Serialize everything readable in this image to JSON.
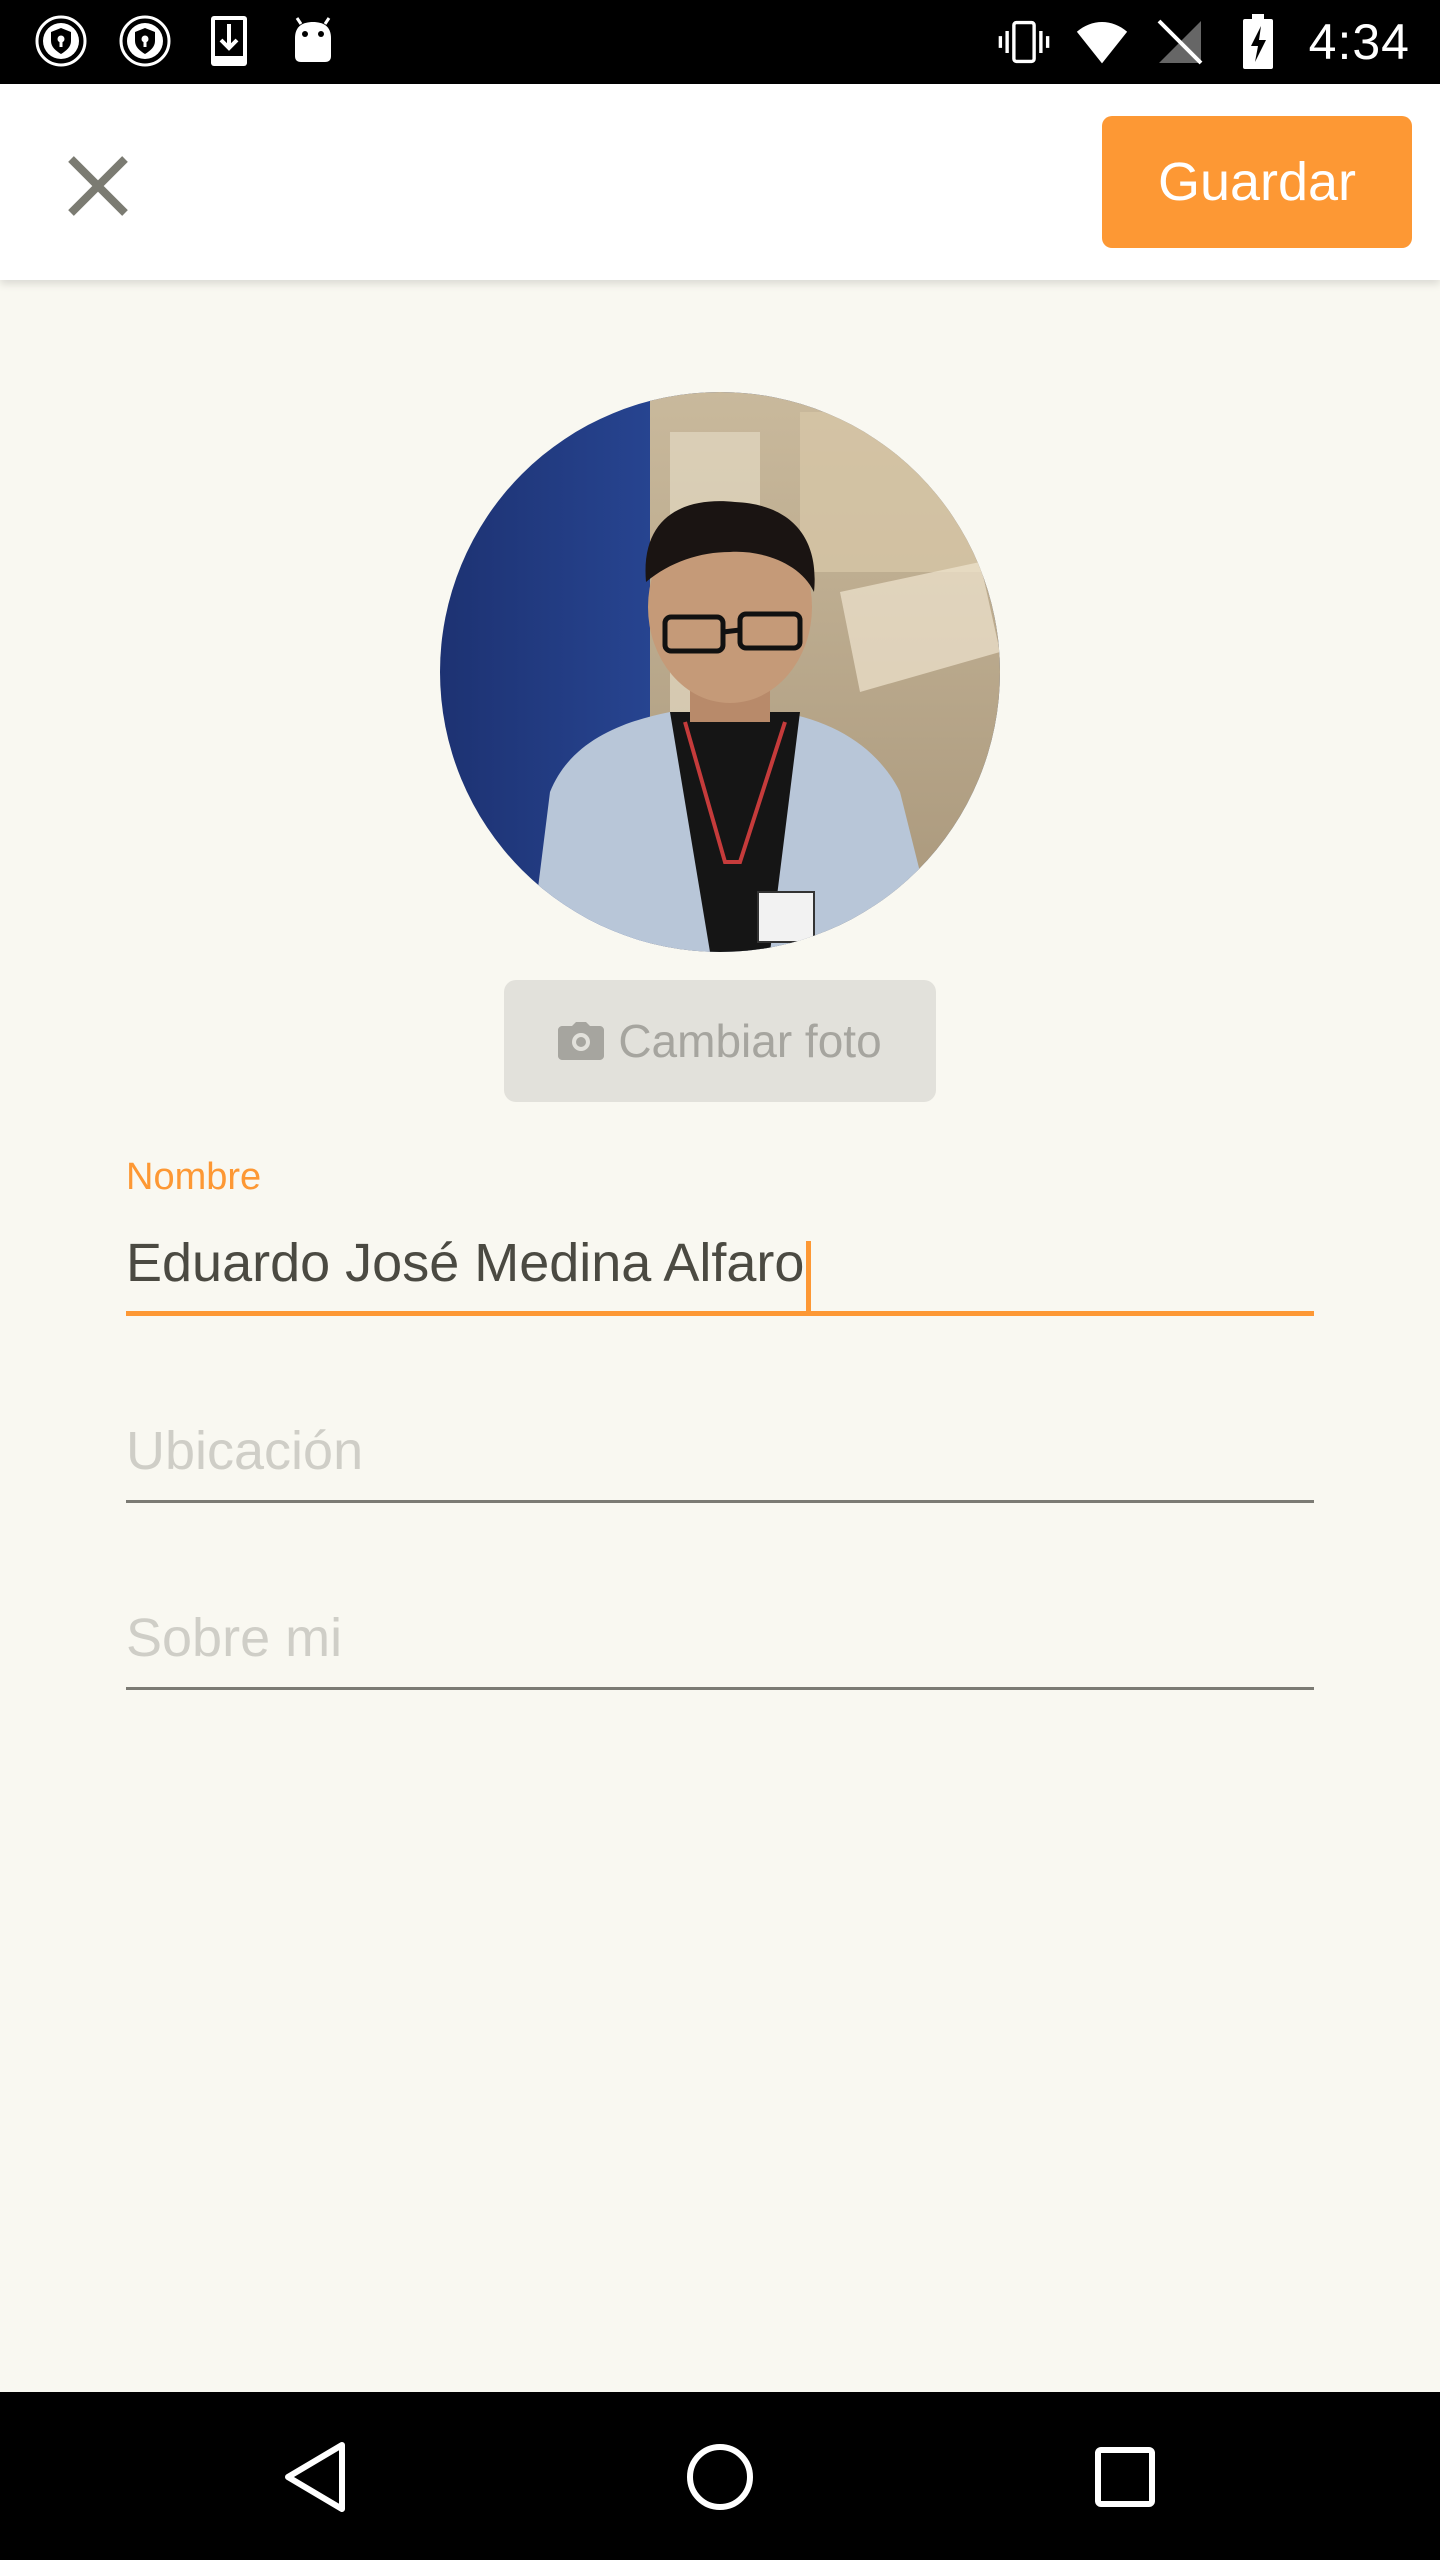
{
  "status_bar": {
    "time": "4:34",
    "left_icons": [
      "shield-notification-icon",
      "shield-notification-icon",
      "download-icon",
      "android-icon"
    ],
    "right_icons": [
      "vibrate-icon",
      "wifi-icon",
      "no-signal-icon",
      "battery-charging-icon"
    ]
  },
  "toolbar": {
    "close_icon": "close-icon",
    "save_label": "Guardar"
  },
  "profile": {
    "change_photo_label": "Cambiar foto",
    "camera_icon": "camera-icon"
  },
  "form": {
    "name_label": "Nombre",
    "name_value": "Eduardo José Medina Alfaro",
    "location_placeholder": "Ubicación",
    "about_placeholder": "Sobre mi"
  },
  "navigation": {
    "back_icon": "back-icon",
    "home_icon": "home-icon",
    "recents_icon": "recents-icon"
  },
  "colors": {
    "accent": "#fd9834",
    "background": "#f9f8f1",
    "text": "#4b4a42",
    "placeholder": "#cfcec7"
  }
}
